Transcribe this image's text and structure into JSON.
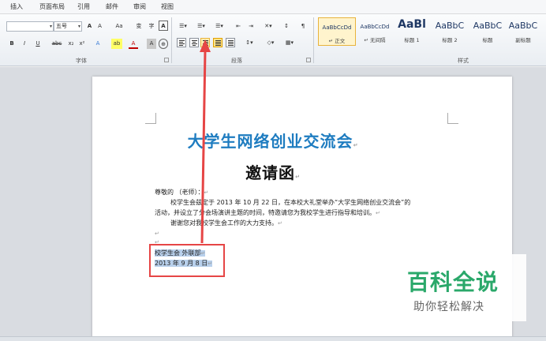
{
  "menu": [
    "插入",
    "页面布局",
    "引用",
    "邮件",
    "审阅",
    "视图"
  ],
  "font": {
    "name_value": "",
    "size_value": "五号",
    "grow_label": "A",
    "shrink_label": "A",
    "case_label": "Aa",
    "phonetic_label": "变",
    "border_char_label": "A",
    "bold": "B",
    "italic": "I",
    "underline": "U",
    "strike": "abc",
    "sub": "x₂",
    "sup": "x²",
    "effects": "A",
    "highlight": "ab",
    "color": "A",
    "shade": "A",
    "enclose": "字",
    "group_label": "字体"
  },
  "paragraph": {
    "group_label": "段落"
  },
  "styles": {
    "group_label": "样式",
    "items": [
      {
        "sample": "AaBbCcDd",
        "name": "↵ 正文",
        "selected": true
      },
      {
        "sample": "AaBbCcDd",
        "name": "↵ 无间隔",
        "selected": false
      },
      {
        "sample": "AaBl",
        "name": "标题 1",
        "selected": false
      },
      {
        "sample": "AaBbC",
        "name": "标题 2",
        "selected": false
      },
      {
        "sample": "AaBbC",
        "name": "标题",
        "selected": false
      },
      {
        "sample": "AaBbC",
        "name": "副标题",
        "selected": false
      }
    ]
  },
  "document": {
    "title": "大学生网络创业交流会",
    "subtitle": "邀请函",
    "salutation": "尊敬的          （老师）：",
    "line1": "校学生会兹定于 2013 年 10 月 22 日，在本校大礼堂举办“大学生网络创业交流会”的",
    "line2": "活动，并设立了分会场演讲主题的时间，特邀请您为我校学生进行指导和培训。",
    "line3": "谢谢您对我校学生会工作的大力支持。",
    "sign1": "校学生会 外联部",
    "sign2": "2013 年 9 月 8 日"
  },
  "watermark": {
    "main": "百科全说",
    "sub": "助你轻松解决"
  },
  "colors": {
    "title": "#1e7cc0",
    "arrow": "#e64545",
    "selection": "#b8d0ec",
    "watermark": "#2aa86a"
  }
}
